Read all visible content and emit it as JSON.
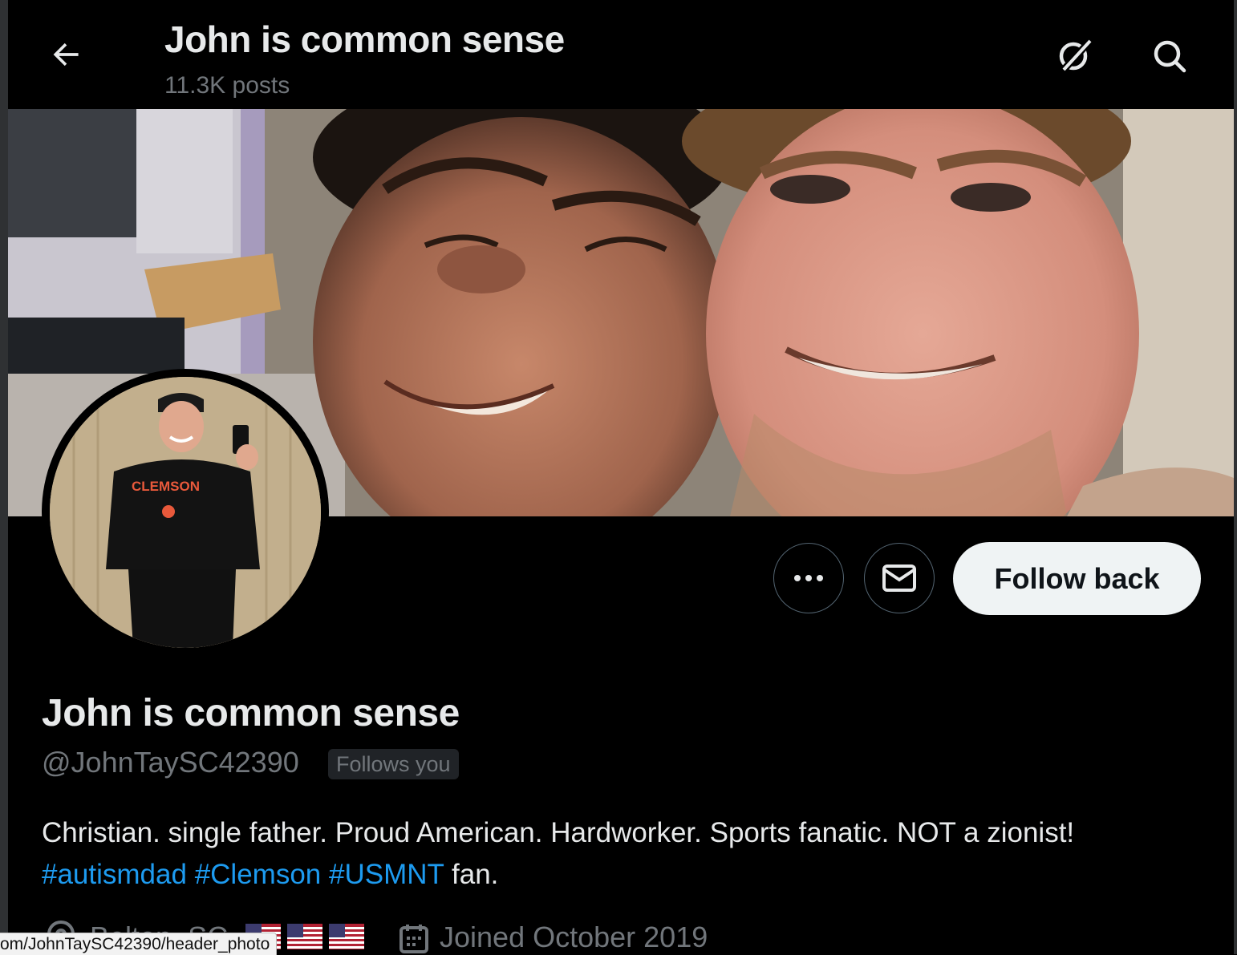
{
  "topbar": {
    "title": "John is common sense",
    "posts_count": "11.3K posts",
    "back_icon": "arrow-left-icon",
    "grok_icon": "grok-icon",
    "search_icon": "search-icon"
  },
  "profile": {
    "display_name": "John is common sense",
    "handle": "@JohnTaySC42390",
    "follows_you_badge": "Follows you",
    "bio_text": "Christian. single father. Proud American. Hardworker. Sports fanatic. NOT a zionist!",
    "bio_hashtags": [
      "#autismdad",
      "#Clemson",
      "#USMNT"
    ],
    "bio_suffix": "fan.",
    "location": "Belton, SC",
    "joined": "Joined October 2019"
  },
  "actions": {
    "more_icon": "more-horizontal-icon",
    "message_icon": "envelope-icon",
    "follow_button": "Follow back"
  },
  "status_bar": {
    "url": "om/JohnTaySC42390/header_photo"
  },
  "colors": {
    "background": "#000000",
    "text_primary": "#e7e9ea",
    "text_secondary": "#71767b",
    "link": "#1d9bf0",
    "follow_button_bg": "#eff3f4"
  }
}
